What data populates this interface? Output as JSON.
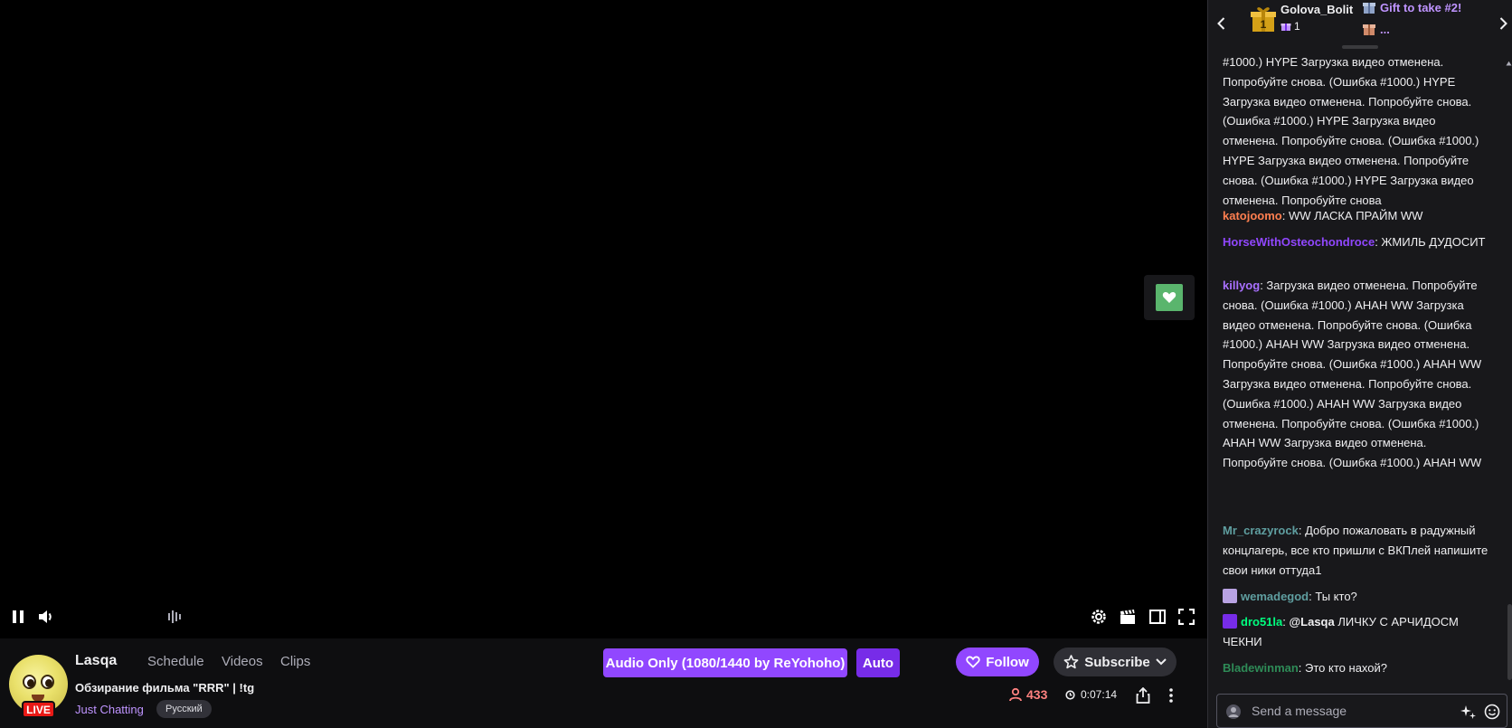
{
  "channel": {
    "name": "Lasqa",
    "live_badge": "LIVE",
    "nav": [
      "Schedule",
      "Videos",
      "Clips"
    ],
    "title": "Обзирание фильма \"RRR\" | !tg",
    "category": "Just Chatting",
    "language_tag": "Русский"
  },
  "player": {
    "quality_button": "Audio Only (1080/1440 by ReYohoho)",
    "auto_button": "Auto"
  },
  "actions": {
    "follow": "Follow",
    "subscribe": "Subscribe",
    "viewers": "433",
    "uptime": "0:07:14"
  },
  "hype": {
    "gifter_name": "Golova_Bolit",
    "gift_count": "1",
    "gift_label": "Gift to take #2!",
    "more": "..."
  },
  "chat": {
    "messages": [
      {
        "user": "",
        "color": "#efeff1",
        "text": "#1000.) HYPE Загрузка видео отменена. Попробуйте снова. (Ошибка #1000.) HYPE Загрузка видео отменена. Попробуйте снова. (Ошибка #1000.) HYPE Загрузка видео отменена. Попробуйте снова. (Ошибка #1000.) HYPE Загрузка видео отменена. Попробуйте снова. (Ошибка #1000.) HYPE Загрузка видео отменена. Попробуйте снова"
      },
      {
        "user": "katojoomo",
        "color": "#ff7f50",
        "text": "WW ЛАСКА ПРАЙМ WW"
      },
      {
        "user": "HorseWithOsteochondroce",
        "color": "#9147ff",
        "text": "ЖМИЛЬ ДУДОСИТ"
      },
      {
        "user": "killyog",
        "color": "#a970ff",
        "text": "Загрузка видео отменена. Попробуйте снова. (Ошибка #1000.) AHAH WW Загрузка видео отменена. Попробуйте снова. (Ошибка #1000.) AHAH WW Загрузка видео отменена. Попробуйте снова. (Ошибка #1000.) AHAH WW Загрузка видео отменена. Попробуйте снова. (Ошибка #1000.) AHAH WW Загрузка видео отменена. Попробуйте снова. (Ошибка #1000.) AHAH WW Загрузка видео отменена. Попробуйте снова. (Ошибка #1000.) AHAH WW"
      },
      {
        "user": "Mr_crazyrock",
        "color": "#5f9ea0",
        "text": "Добро пожаловать в радужный концлагерь, все кто пришли с ВКПлей напишите свои ники оттуда1"
      },
      {
        "user": "wemadegod",
        "color": "#5f9ea0",
        "text": "Ты кто?"
      },
      {
        "user": "dro51la",
        "color": "#00ff7f",
        "mention": "@Lasqa",
        "text": "ЛИЧКУ С АРЧИДОСМ ЧЕКНИ"
      },
      {
        "user": "Bladewinman",
        "color": "#2e8b57",
        "text": "Это кто нахой?"
      }
    ],
    "input_placeholder": "Send a message"
  }
}
